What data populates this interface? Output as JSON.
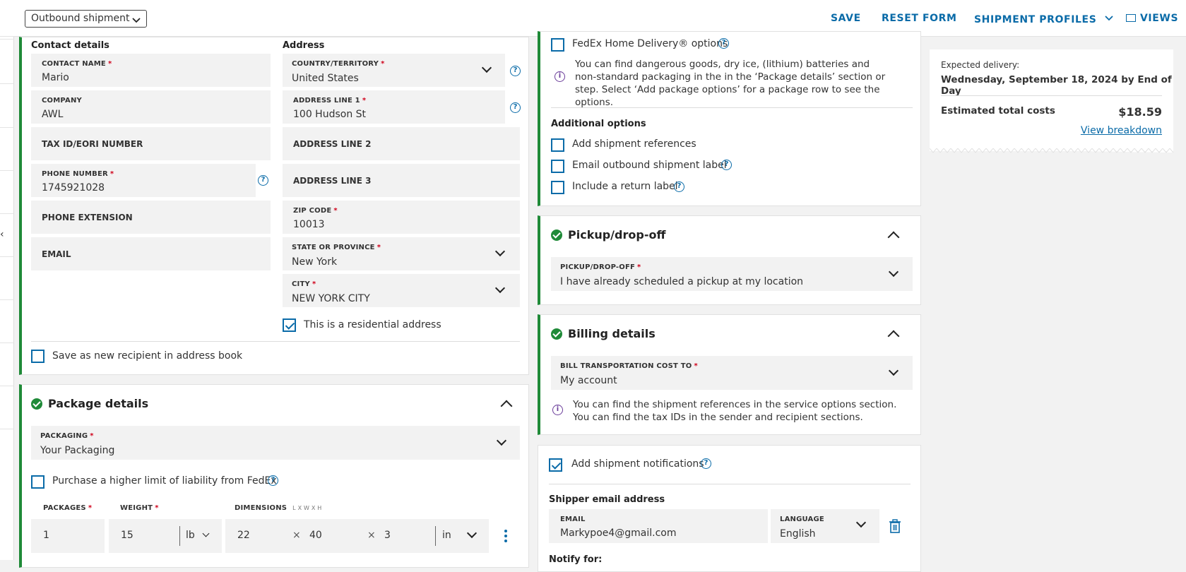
{
  "toolbar": {
    "shipment_type": "Outbound shipment",
    "save": "SAVE",
    "reset": "RESET FORM",
    "profiles": "SHIPMENT PROFILES",
    "views": "VIEWS"
  },
  "recipient": {
    "contact_title": "Contact details",
    "address_title": "Address",
    "contact_name_label": "CONTACT NAME",
    "contact_name": "Mario",
    "company_label": "COMPANY",
    "company": "AWL",
    "tax_label": "TAX ID/EORI NUMBER",
    "phone_label": "PHONE NUMBER",
    "phone": "1745921028",
    "phone_ext_label": "PHONE EXTENSION",
    "email_label": "EMAIL",
    "country_label": "COUNTRY/TERRITORY",
    "country": "United States",
    "addr1_label": "ADDRESS LINE 1",
    "addr1": "100 Hudson St",
    "addr2_label": "ADDRESS LINE 2",
    "addr3_label": "ADDRESS LINE 3",
    "zip_label": "ZIP CODE",
    "zip": "10013",
    "state_label": "STATE OR PROVINCE",
    "state": "New York",
    "city_label": "CITY",
    "city": "NEW YORK CITY",
    "residential": "This is a residential address",
    "residential_checked": true,
    "save_recipient": "Save as new recipient in address book"
  },
  "package": {
    "title": "Package details",
    "packaging_label": "PACKAGING",
    "packaging": "Your Packaging",
    "liability": "Purchase a higher limit of liability from FedEx",
    "packages_label": "PACKAGES",
    "packages": "1",
    "weight_label": "WEIGHT",
    "weight": "15",
    "weight_unit": "lb",
    "dims_label": "DIMENSIONS",
    "dims_hint": "L x W x H",
    "length": "22",
    "width": "40",
    "height": "3",
    "dims_unit": "in",
    "times": "×"
  },
  "options": {
    "home_delivery": "FedEx Home Delivery® options",
    "dg_note": "You can find dangerous goods, dry ice, (lithium) batteries and non-standard packaging in the in the ‘Package details’ section or step. Select ‘Add package options’ for a package row to see the options.",
    "additional_title": "Additional options",
    "add_refs": "Add shipment references",
    "email_label": "Email outbound shipment label",
    "return_label": "Include a return label"
  },
  "pickup": {
    "title": "Pickup/drop-off",
    "field_label": "PICKUP/DROP-OFF",
    "value": "I have already scheduled a pickup at my location"
  },
  "billing": {
    "title": "Billing details",
    "field_label": "BILL TRANSPORTATION COST TO",
    "value": "My account",
    "note": "You can find the shipment references in the service options section. You can find the tax IDs in the sender and recipient sections."
  },
  "notifications": {
    "add": "Add shipment notifications",
    "checked": true,
    "shipper_title": "Shipper email address",
    "email_label": "EMAIL",
    "email": "Markypoe4@gmail.com",
    "language_label": "LANGUAGE",
    "language": "English",
    "notify_for": "Notify for:"
  },
  "summary": {
    "expected_label": "Expected delivery:",
    "expected_date": "Wednesday, September 18, 2024 by End of Day",
    "total_label": "Estimated total costs",
    "total_value": "$18.59",
    "breakdown": "View breakdown"
  },
  "icons": {
    "help": "?",
    "info": "i",
    "required": "*"
  }
}
